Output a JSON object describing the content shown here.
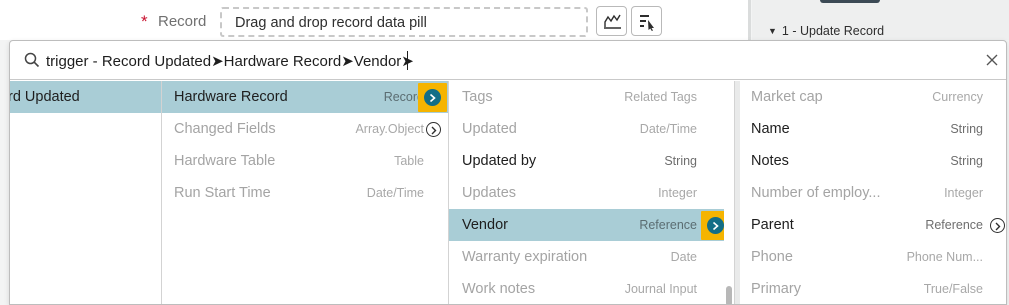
{
  "form": {
    "required_marker": "*",
    "record_label": "Record",
    "drop_placeholder": "Drag and drop record data pill",
    "tool_buttons": [
      {
        "icon": "data-pill-icon"
      },
      {
        "icon": "pill-picker-icon"
      }
    ]
  },
  "side_panel": {
    "header": "1 - Update Record"
  },
  "picker": {
    "search_value": "trigger - Record Updated➤Hardware Record➤Vendor➤",
    "columns": [
      {
        "items": [
          {
            "name": "rd Updated",
            "type": "",
            "state": "selected",
            "has_children": false
          }
        ]
      },
      {
        "items": [
          {
            "name": "Hardware Record",
            "type": "Record",
            "state": "selected",
            "has_children": true,
            "highlighted": true
          },
          {
            "name": "Changed Fields",
            "type": "Array.Object",
            "state": "dim",
            "has_children": true
          },
          {
            "name": "Hardware Table",
            "type": "Table",
            "state": "dim",
            "has_children": false
          },
          {
            "name": "Run Start Time",
            "type": "Date/Time",
            "state": "dim",
            "has_children": false
          }
        ]
      },
      {
        "items": [
          {
            "name": "Tags",
            "type": "Related Tags",
            "state": "dim",
            "has_children": false
          },
          {
            "name": "Updated",
            "type": "Date/Time",
            "state": "dim",
            "has_children": false
          },
          {
            "name": "Updated by",
            "type": "String",
            "state": "normal",
            "has_children": false
          },
          {
            "name": "Updates",
            "type": "Integer",
            "state": "dim",
            "has_children": false
          },
          {
            "name": "Vendor",
            "type": "Reference",
            "state": "selected",
            "has_children": true,
            "highlighted": true
          },
          {
            "name": "Warranty expiration",
            "type": "Date",
            "state": "dim",
            "has_children": false
          },
          {
            "name": "Work notes",
            "type": "Journal Input",
            "state": "dim",
            "has_children": false
          }
        ]
      },
      {
        "items": [
          {
            "name": "Market cap",
            "type": "Currency",
            "state": "dim",
            "has_children": false
          },
          {
            "name": "Name",
            "type": "String",
            "state": "normal",
            "has_children": false
          },
          {
            "name": "Notes",
            "type": "String",
            "state": "normal",
            "has_children": false
          },
          {
            "name": "Number of employ...",
            "type": "Integer",
            "state": "dim",
            "has_children": false
          },
          {
            "name": "Parent",
            "type": "Reference",
            "state": "normal",
            "has_children": true
          },
          {
            "name": "Phone",
            "type": "Phone Num...",
            "state": "dim",
            "has_children": false
          },
          {
            "name": "Primary",
            "type": "True/False",
            "state": "dim",
            "has_children": false
          }
        ]
      }
    ]
  },
  "colors": {
    "selected_row": "#a9cdd6",
    "highlight_box": "#f5b400",
    "expand_button": "#136e87",
    "required": "#c8102e"
  }
}
